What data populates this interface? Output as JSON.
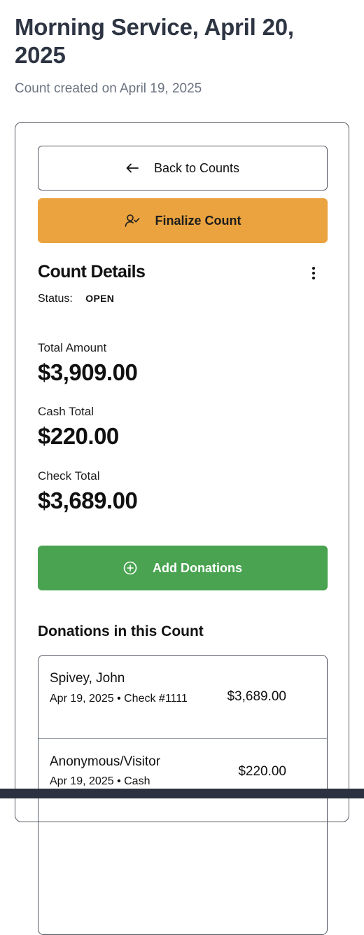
{
  "header": {
    "title": "Morning Service, April 20, 2025",
    "subtitle": "Count created on April 19, 2025"
  },
  "actions": {
    "back_label": "Back to Counts",
    "back_icon": "arrow-left-icon",
    "finalize_label": "Finalize Count",
    "finalize_icon": "user-check-icon",
    "finalize_color": "#eaa33e",
    "add_label": "Add Donations",
    "add_icon": "plus-circle-icon",
    "add_color": "#49a350"
  },
  "details": {
    "title": "Count Details",
    "menu_icon": "more-vertical-icon",
    "status_label": "Status:",
    "status_value": "OPEN"
  },
  "totals": [
    {
      "label": "Total Amount",
      "value": "$3,909.00"
    },
    {
      "label": "Cash Total",
      "value": "$220.00"
    },
    {
      "label": "Check Total",
      "value": "$3,689.00"
    }
  ],
  "donations": {
    "title": "Donations in this Count",
    "items": [
      {
        "name": "Spivey, John",
        "meta": "Apr 19, 2025 • Check #1111",
        "amount": "$3,689.00"
      },
      {
        "name": "Anonymous/Visitor",
        "meta": "Apr 19, 2025 • Cash",
        "amount": "$220.00"
      }
    ]
  }
}
